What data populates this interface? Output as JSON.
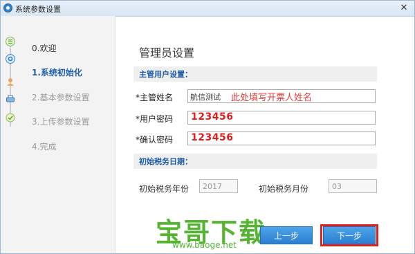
{
  "window": {
    "title": "系统参数设置",
    "close_symbol": "✕"
  },
  "sidebar": {
    "steps": [
      {
        "label": "0.欢迎",
        "state": "done"
      },
      {
        "label": "1.系统初始化",
        "state": "current"
      },
      {
        "label": "2.基本参数设置",
        "state": "pending"
      },
      {
        "label": "3.上传参数设置",
        "state": "pending"
      },
      {
        "label": "4.完成",
        "state": "pending"
      }
    ],
    "step_icons": [
      "document-icon",
      "gear-icon",
      "user-icon",
      "printer-icon",
      "check-icon"
    ]
  },
  "main": {
    "heading": "管理员设置",
    "section_admin": "主管用户设置：",
    "fields": [
      {
        "label": "*主管姓名",
        "value": "航信测试",
        "hint": "此处填写开票人姓名"
      },
      {
        "label": "*用户密码",
        "value": "123456"
      },
      {
        "label": "*确认密码",
        "value": "123456"
      }
    ],
    "section_tax": "初始税务日期：",
    "tax_year_label": "初始税务年份",
    "tax_year_value": "2017",
    "tax_month_label": "初始税务月份",
    "tax_month_value": "03"
  },
  "buttons": {
    "prev": "上一步",
    "next": "下一步"
  },
  "watermark": {
    "text": "宝哥下载",
    "url": "www.baoge.net"
  },
  "colors": {
    "accent_blue": "#2a7fd1",
    "highlight_red": "#e0221f",
    "watermark_green": "#55b532"
  }
}
